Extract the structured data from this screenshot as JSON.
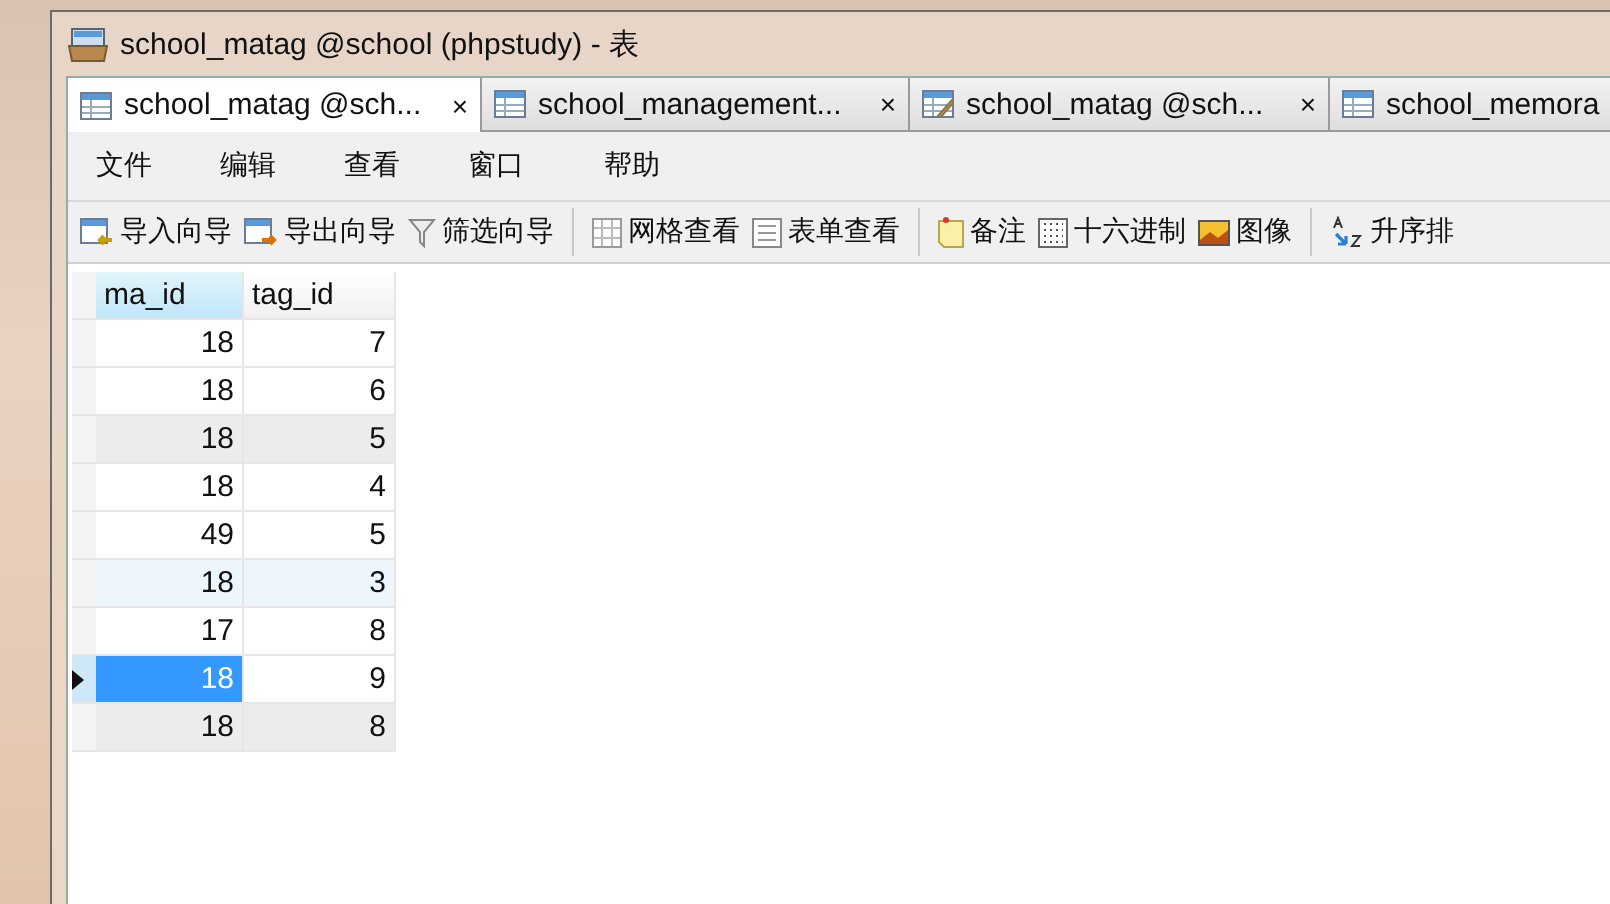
{
  "window": {
    "title": "school_matag @school (phpstudy) - 表"
  },
  "tabs": [
    {
      "label": "school_matag @sch...",
      "kind": "table",
      "close": "×",
      "selected": true
    },
    {
      "label": "school_management...",
      "kind": "table",
      "close": "×",
      "selected": false
    },
    {
      "label": "school_matag @sch...",
      "kind": "design",
      "close": "×",
      "selected": false
    },
    {
      "label": "school_memora",
      "kind": "table",
      "selected": false
    }
  ],
  "menu": [
    "文件",
    "编辑",
    "查看",
    "窗口",
    "帮助"
  ],
  "toolbar": [
    [
      {
        "label": "导入向导",
        "kind": "import"
      },
      {
        "label": "导出向导",
        "kind": "export"
      },
      {
        "label": "筛选向导",
        "kind": "filter"
      }
    ],
    [
      {
        "label": "网格查看",
        "kind": "grid"
      },
      {
        "label": "表单查看",
        "kind": "form"
      }
    ],
    [
      {
        "label": "备注",
        "kind": "note"
      },
      {
        "label": "十六进制",
        "kind": "hex"
      },
      {
        "label": "图像",
        "kind": "image"
      }
    ],
    [
      {
        "label": "升序排",
        "kind": "sort"
      }
    ]
  ],
  "table": {
    "columns": [
      {
        "label": "ma_id",
        "selected": true
      },
      {
        "label": "tag_id",
        "selected": false
      }
    ],
    "rows": [
      {
        "cells": [
          "18",
          "7"
        ],
        "selected": false,
        "hovered": false,
        "current": false
      },
      {
        "cells": [
          "18",
          "6"
        ],
        "selected": false,
        "hovered": false,
        "current": false
      },
      {
        "cells": [
          "18",
          "5"
        ],
        "selected": true,
        "hovered": false,
        "current": false
      },
      {
        "cells": [
          "18",
          "4"
        ],
        "selected": false,
        "hovered": false,
        "current": false
      },
      {
        "cells": [
          "49",
          "5"
        ],
        "selected": false,
        "hovered": false,
        "current": false
      },
      {
        "cells": [
          "18",
          "3"
        ],
        "selected": false,
        "hovered": true,
        "current": false
      },
      {
        "cells": [
          "17",
          "8"
        ],
        "selected": false,
        "hovered": false,
        "current": false
      },
      {
        "cells": [
          "18",
          "9"
        ],
        "selected": false,
        "hovered": false,
        "current": true
      },
      {
        "cells": [
          "18",
          "8"
        ],
        "selected": true,
        "hovered": false,
        "current": false
      }
    ]
  }
}
